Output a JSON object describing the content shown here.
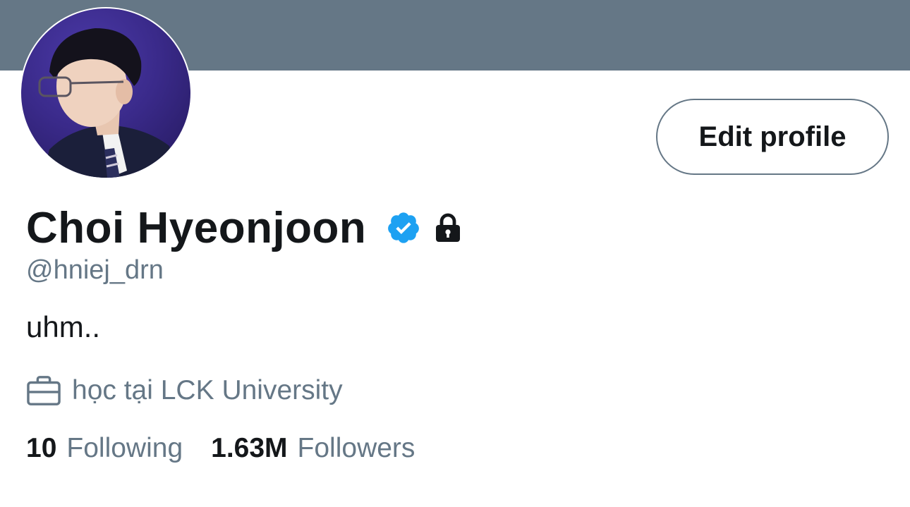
{
  "profile": {
    "display_name": "Choi Hyeonjoon",
    "handle": "@hniej_drn",
    "bio": "uhm..",
    "occupation": "học tại LCK University",
    "verified": true,
    "protected": true
  },
  "actions": {
    "edit_profile_label": "Edit profile"
  },
  "stats": {
    "following_count": "10",
    "following_label": "Following",
    "followers_count": "1.63M",
    "followers_label": "Followers"
  },
  "icons": {
    "verified": "verified-badge-icon",
    "protected": "lock-icon",
    "occupation": "briefcase-icon"
  },
  "colors": {
    "banner": "#657786",
    "verified": "#1da1f2",
    "text_primary": "#14171a",
    "text_secondary": "#657786"
  }
}
